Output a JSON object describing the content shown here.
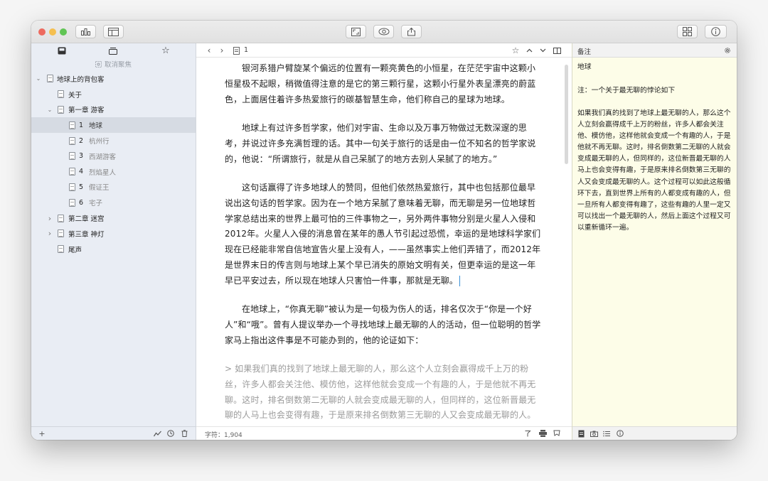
{
  "toolbar": {
    "buttons_left": [
      "stats-icon",
      "layout-icon"
    ],
    "buttons_center": [
      "fullscreen-icon",
      "preview-icon",
      "share-icon"
    ],
    "buttons_right": [
      "grid-icon",
      "info-icon"
    ],
    "traffic_lights": {
      "close": "#ed6a5e",
      "minimize": "#f5bf4f",
      "zoom": "#61c554"
    }
  },
  "sidebar": {
    "unfocus_label": "取消聚焦",
    "tree": [
      {
        "label": "地球上的背包客",
        "level": 0,
        "chevron": "⌄"
      },
      {
        "label": "关于",
        "level": 1
      },
      {
        "label": "第一章 游客",
        "level": 1,
        "chevron": "⌄"
      },
      {
        "num": "1",
        "label": "地球",
        "level": 2,
        "selected": true
      },
      {
        "num": "2",
        "label": "杭州行",
        "level": 2
      },
      {
        "num": "3",
        "label": "西湖游客",
        "level": 2
      },
      {
        "num": "4",
        "label": "烈焰星人",
        "level": 2
      },
      {
        "num": "5",
        "label": "假证王",
        "level": 2
      },
      {
        "num": "6",
        "label": "宅子",
        "level": 2
      },
      {
        "label": "第二章 迷宫",
        "level": 1,
        "chevron": "›"
      },
      {
        "label": "第三章 神灯",
        "level": 1,
        "chevron": "›"
      },
      {
        "label": "尾声",
        "level": 1
      }
    ],
    "footer": {
      "add": "+"
    }
  },
  "editor": {
    "page_number": "1",
    "paragraphs": [
      "银河系猎户臂旋某个偏远的位置有一颗亮黄色的小恒星，在茫茫宇宙中这颗小恒星极不起眼，稍微值得注意的是它的第三颗行星，这颗小行星外表呈漂亮的蔚蓝色，上面居住着许多热爱旅行的碳基智慧生命，他们称自己的星球为地球。",
      "地球上有过许多哲学家，他们对宇宙、生命以及万事万物做过无数深邃的思考，并说过许多充满哲理的话。其中一句关于旅行的话是由一位不知名的哲学家说的，他说：“所谓旅行，就是从自己呆腻了的地方去别人呆腻了的地方。”",
      "这句话赢得了许多地球人的赞同，但他们依然热爱旅行，其中也包括那位最早说出这句话的哲学家。因为在一个地方呆腻了意味着无聊，而无聊是另一位地球哲学家总结出来的世界上最可怕的三件事物之一，另外两件事物分别是火星人入侵和2012年。火星人入侵的消息曾在某年的愚人节引起过恐慌，幸运的是地球科学家们现在已经能非常自信地宣告火星上没有人，——虽然事实上他们弄错了，而2012年是世界末日的传言则与地球上某个早已消失的原始文明有关，但更幸运的是这一年早已平安过去，所以现在地球人只害怕一件事，那就是无聊。",
      "在地球上，“你真无聊”被认为是一句极为伤人的话，排名仅次于“你是一个好人”和“哦”。曾有人提议举办一个寻找地球上最无聊的人的活动，但一位聪明的哲学家马上指出这件事是不可能办到的，他的论证如下：",
      "> 如果我们真的找到了地球上最无聊的人，那么这个人立刻会赢得成千上万的粉丝，许多人都会关注他、模仿他，这样他就会变成一个有趣的人，于是他就不再无聊。这时，排名倒数第二无聊的人就会变成最无聊的人，但同样的，这位新晋最无聊的人马上也会变得有趣，于是原来排名倒数第三无聊的人又会变成最无聊的人。"
    ],
    "footer_label": "字符：1,904"
  },
  "inspector": {
    "title": "备注",
    "note_title": "地球",
    "note_subtitle": "注：一个关于最无聊的悖论如下",
    "note_body": "如果我们真的找到了地球上最无聊的人，那么这个人立刻会赢得成千上万的粉丝，许多人都会关注他、模仿他，这样他就会变成一个有趣的人，于是他就不再无聊。这时，排名倒数第二无聊的人就会变成最无聊的人，但同样的，这位新晋最无聊的人马上也会变得有趣，于是原来排名倒数第三无聊的人又会变成最无聊的人。这个过程可以如此这般循环下去，直到世界上所有的人都变成有趣的人，但一旦所有人都变得有趣了，这些有趣的人里一定又可以找出一个最无聊的人，然后上面这个过程又可以重新循环一遍。"
  }
}
